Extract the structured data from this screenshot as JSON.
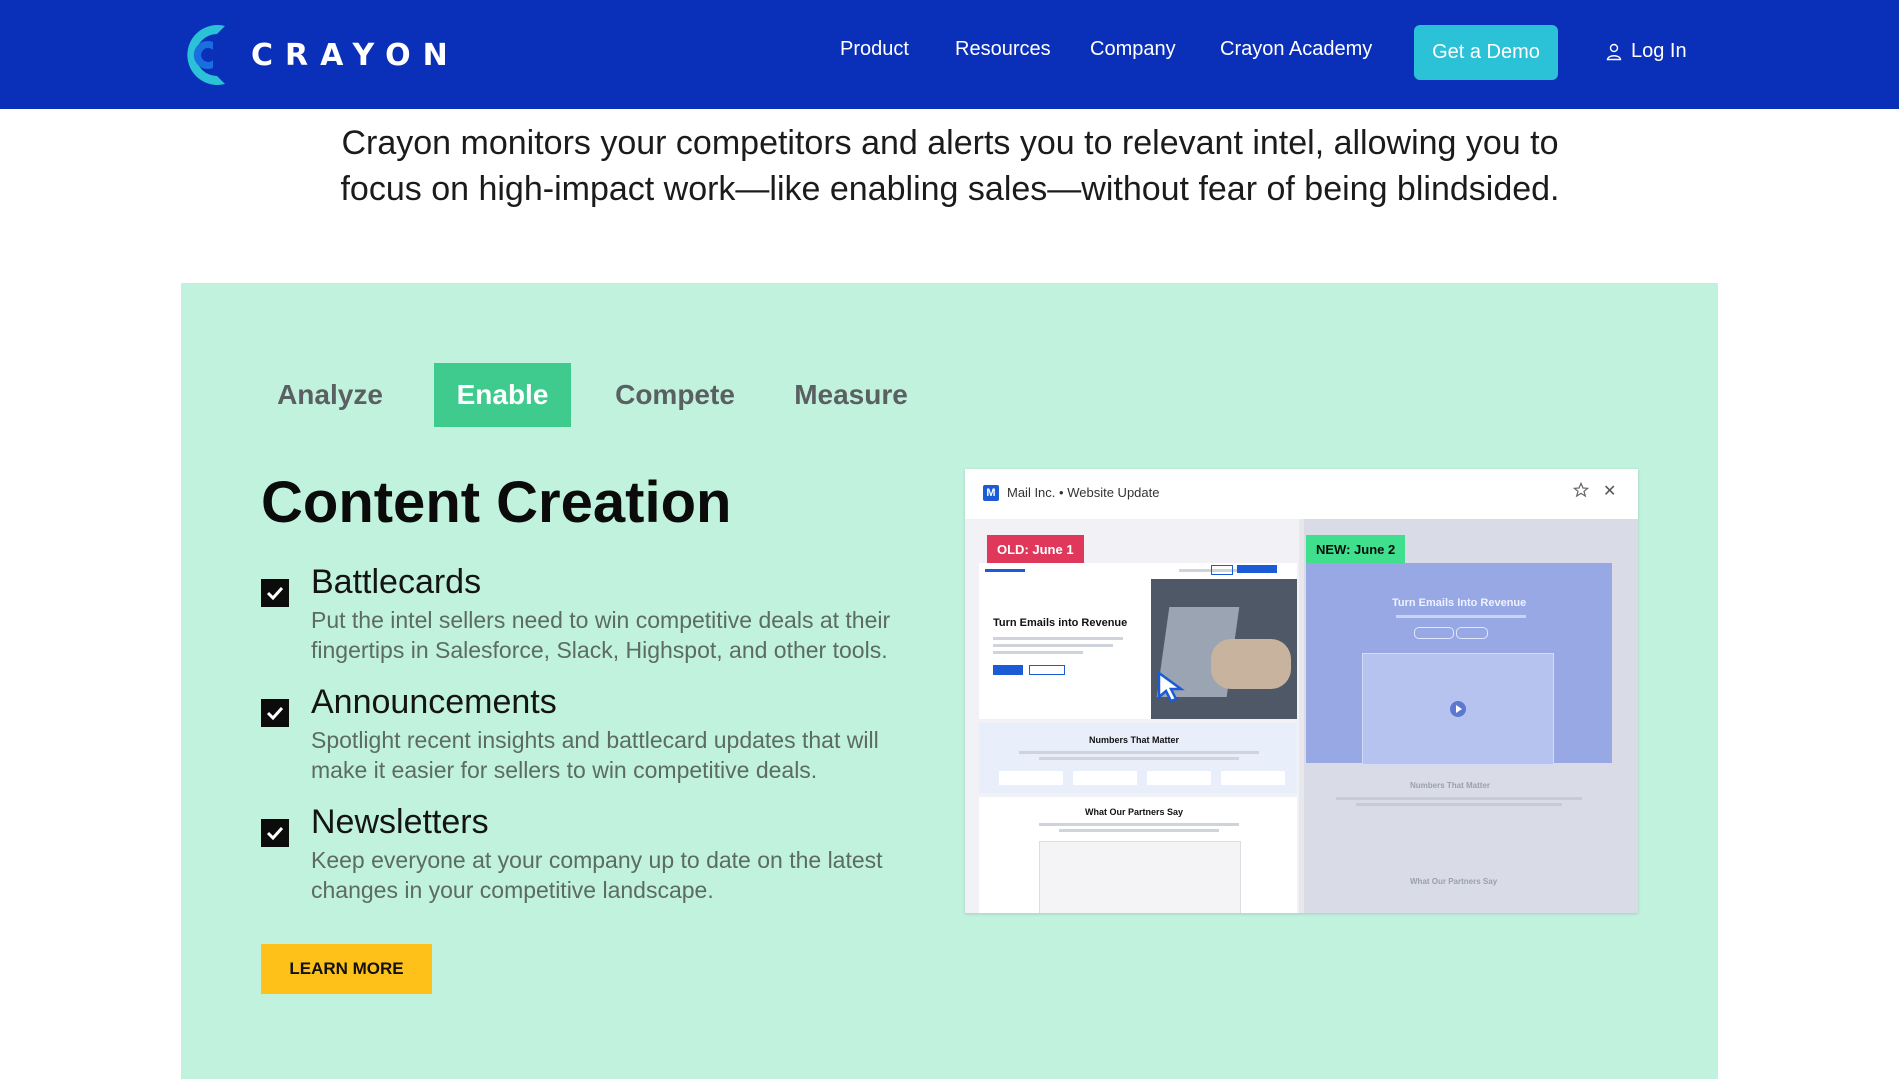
{
  "nav": {
    "logo_text": "CRAYON",
    "links": [
      "Product",
      "Resources",
      "Company",
      "Crayon Academy"
    ],
    "demo_label": "Get a Demo",
    "login_label": "Log In"
  },
  "intro": {
    "line1": "Crayon monitors your competitors and alerts you to relevant intel, allowing you to",
    "line2": "focus on high-impact work—like enabling sales—without fear of being blindsided."
  },
  "tabs": [
    {
      "label": "Analyze",
      "active": false
    },
    {
      "label": "Enable",
      "active": true
    },
    {
      "label": "Compete",
      "active": false
    },
    {
      "label": "Measure",
      "active": false
    }
  ],
  "section": {
    "heading": "Content Creation",
    "features": [
      {
        "title": "Battlecards",
        "description": "Put the intel sellers need to win competitive deals at their fingertips in Salesforce, Slack, Highspot, and other tools."
      },
      {
        "title": "Announcements",
        "description": "Spotlight recent insights and battlecard updates that will make it easier for sellers to win competitive deals."
      },
      {
        "title": "Newsletters",
        "description": "Keep everyone at your company up to date on the latest changes in your competitive landscape."
      }
    ],
    "learn_more": "LEARN MORE"
  },
  "preview": {
    "favicon": "M",
    "company": "Mail Inc.",
    "separator": "•",
    "update_type": "Website Update",
    "old_badge": "OLD: June 1",
    "new_badge": "NEW: June 2",
    "old_hero": "Turn Emails into Revenue",
    "old_numbers": "Numbers That Matter",
    "old_partners": "What Our Partners Say",
    "new_hero": "Turn Emails Into Revenue",
    "new_numbers": "Numbers That Matter",
    "new_partners": "What Our Partners Say"
  },
  "colors": {
    "nav_bg": "#0a2fb8",
    "demo_btn": "#2bc1d6",
    "panel_bg": "#c1f2de",
    "active_tab": "#3fcb8d",
    "learn_btn": "#fdc11a",
    "old_badge": "#e0385a",
    "new_badge": "#3fdf8d"
  }
}
